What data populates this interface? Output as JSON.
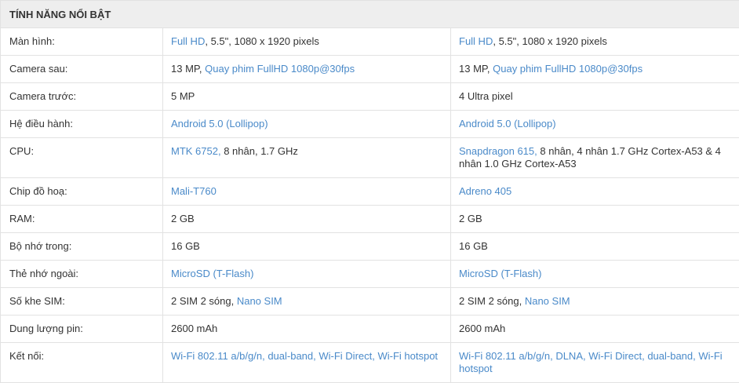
{
  "header": {
    "title": "TÍNH NĂNG NỔI BẬT"
  },
  "rows": [
    {
      "label": "Màn hình:",
      "h": 35,
      "a": [
        {
          "t": "Full HD",
          "link": true
        },
        {
          "t": ", 5.5\", 1080 x 1920 pixels",
          "link": false
        }
      ],
      "b": [
        {
          "t": "Full HD",
          "link": true
        },
        {
          "t": ", 5.5\", 1080 x 1920 pixels",
          "link": false
        }
      ]
    },
    {
      "label": "Camera sau:",
      "h": 35,
      "a": [
        {
          "t": "13 MP, ",
          "link": false
        },
        {
          "t": "Quay phim FullHD 1080p@30fps",
          "link": true
        }
      ],
      "b": [
        {
          "t": "13 MP, ",
          "link": false
        },
        {
          "t": "Quay phim FullHD 1080p@30fps",
          "link": true
        }
      ]
    },
    {
      "label": "Camera trước:",
      "h": 35,
      "a": [
        {
          "t": "5 MP",
          "link": false
        }
      ],
      "b": [
        {
          "t": "4 Ultra pixel",
          "link": false
        }
      ]
    },
    {
      "label": "Hệ điều hành:",
      "h": 35,
      "a": [
        {
          "t": "Android 5.0 (Lollipop)",
          "link": true
        }
      ],
      "b": [
        {
          "t": "Android 5.0 (Lollipop)",
          "link": true
        }
      ]
    },
    {
      "label": "CPU:",
      "h": 51,
      "a": [
        {
          "t": "MTK 6752,",
          "link": true
        },
        {
          "t": " 8 nhân, 1.7 GHz",
          "link": false
        }
      ],
      "b": [
        {
          "t": "Snapdragon 615,",
          "link": true
        },
        {
          "t": " 8 nhân, 4 nhân 1.7 GHz Cortex-A53 & 4 nhân 1.0 GHz Cortex-A53",
          "link": false
        }
      ]
    },
    {
      "label": "Chip đồ hoạ:",
      "h": 35,
      "a": [
        {
          "t": "Mali-T760",
          "link": true
        }
      ],
      "b": [
        {
          "t": "Adreno 405",
          "link": true
        }
      ]
    },
    {
      "label": "RAM:",
      "h": 35,
      "a": [
        {
          "t": "2 GB",
          "link": false
        }
      ],
      "b": [
        {
          "t": "2 GB",
          "link": false
        }
      ]
    },
    {
      "label": "Bộ nhớ trong:",
      "h": 35,
      "a": [
        {
          "t": "16 GB",
          "link": false
        }
      ],
      "b": [
        {
          "t": "16 GB",
          "link": false
        }
      ]
    },
    {
      "label": "Thẻ nhớ ngoài:",
      "h": 35,
      "a": [
        {
          "t": "MicroSD (T-Flash)",
          "link": true
        }
      ],
      "b": [
        {
          "t": "MicroSD (T-Flash)",
          "link": true
        }
      ]
    },
    {
      "label": "Số khe SIM:",
      "h": 35,
      "a": [
        {
          "t": "2 SIM 2 sóng, ",
          "link": false
        },
        {
          "t": "Nano SIM",
          "link": true
        }
      ],
      "b": [
        {
          "t": "2 SIM 2 sóng, ",
          "link": false
        },
        {
          "t": "Nano SIM",
          "link": true
        }
      ]
    },
    {
      "label": "Dung lượng pin:",
      "h": 35,
      "a": [
        {
          "t": "2600 mAh",
          "link": false
        }
      ],
      "b": [
        {
          "t": "2600 mAh",
          "link": false
        }
      ]
    },
    {
      "label": "Kết nối:",
      "h": 51,
      "a": [
        {
          "t": "Wi-Fi 802.11 a/b/g/n, dual-band, Wi-Fi Direct, Wi-Fi hotspot",
          "link": true
        }
      ],
      "b": [
        {
          "t": "Wi-Fi 802.11 a/b/g/n, DLNA, Wi-Fi Direct, dual-band, Wi-Fi hotspot",
          "link": true
        }
      ]
    }
  ]
}
